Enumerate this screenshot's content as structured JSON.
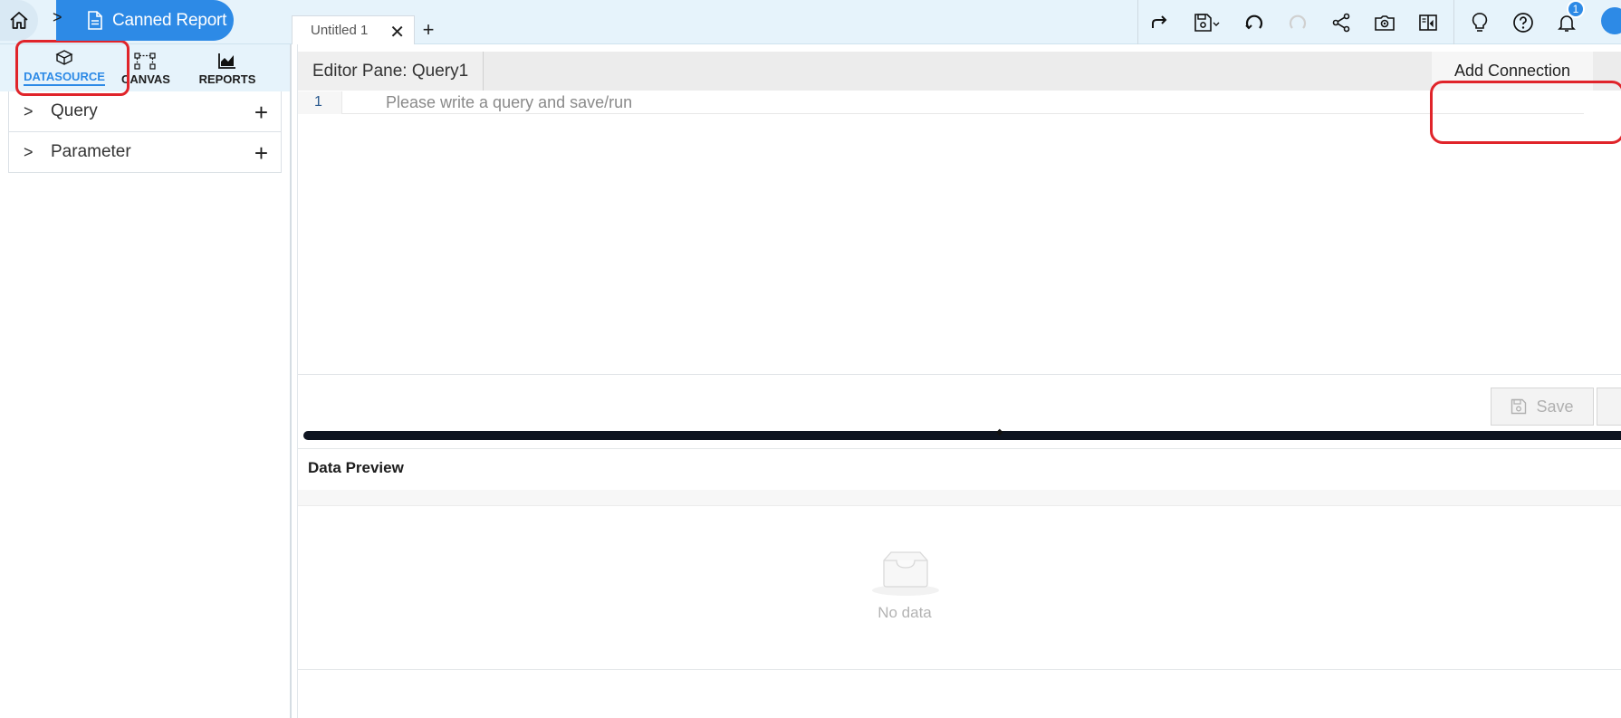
{
  "breadcrumb": {
    "current": "Canned Report"
  },
  "tabs": [
    {
      "label": "Untitled 1",
      "close": "✕"
    }
  ],
  "tab_add": "+",
  "notifications": {
    "count": "1"
  },
  "sidebar": {
    "tabs": [
      {
        "label": "DATASOURCE",
        "icon": "database-icon",
        "active": true
      },
      {
        "label": "CANVAS",
        "icon": "canvas-icon",
        "active": false
      },
      {
        "label": "REPORTS",
        "icon": "chart-icon",
        "active": false
      }
    ],
    "items": [
      {
        "label": "Query",
        "chevron": ">",
        "add": "+"
      },
      {
        "label": "Parameter",
        "chevron": ">",
        "add": "+"
      }
    ]
  },
  "editor": {
    "title": "Editor Pane: Query1",
    "add_connection": "Add Connection",
    "line_number": "1",
    "placeholder": "Please write a query and save/run",
    "save_label": "Save"
  },
  "data_preview": {
    "title": "Data Preview",
    "empty_text": "No data"
  },
  "colors": {
    "accent": "#2d8ae6",
    "topbar_bg": "#e6f3fb",
    "highlight": "#e0242a",
    "splitter": "#0e1420"
  }
}
